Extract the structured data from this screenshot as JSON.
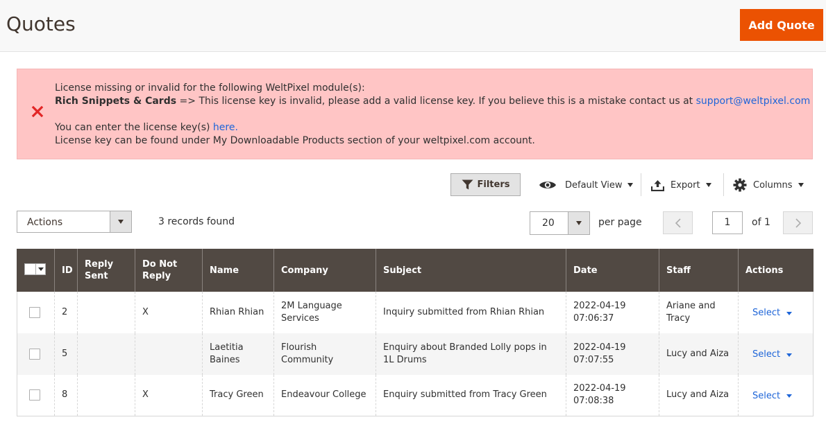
{
  "header": {
    "title": "Quotes",
    "add_button": "Add Quote"
  },
  "message": {
    "line1": "License missing or invalid for the following WeltPixel module(s):",
    "module_name": "Rich Snippets & Cards",
    "line2_rest": " => This license key is invalid, please add a valid license key. If you believe this is a mistake contact us at ",
    "support_email": "support@weltpixel.com",
    "line3_prefix": "You can enter the license key(s) ",
    "here_link": "here.",
    "line4": "License key can be found under My Downloadable Products section of your weltpixel.com account."
  },
  "toolbar": {
    "filters": "Filters",
    "view": "Default View",
    "export": "Export",
    "columns": "Columns"
  },
  "grid_controls": {
    "actions_label": "Actions",
    "records_found": "3 records found",
    "per_page_value": "20",
    "per_page_label": "per page",
    "current_page": "1",
    "page_of": "of 1"
  },
  "table": {
    "columns": [
      "ID",
      "Reply Sent",
      "Do Not Reply",
      "Name",
      "Company",
      "Subject",
      "Date",
      "Staff",
      "Actions"
    ],
    "rows": [
      {
        "id": "2",
        "reply_sent": "",
        "do_not_reply": "X",
        "name": "Rhian Rhian",
        "company": "2M Language Services",
        "subject": "Inquiry submitted from Rhian Rhian",
        "date": "2022-04-19 07:06:37",
        "staff": "Ariane and Tracy",
        "action": "Select"
      },
      {
        "id": "5",
        "reply_sent": "",
        "do_not_reply": "",
        "name": "Laetitia Baines",
        "company": "Flourish Community",
        "subject": "Enquiry about Branded Lolly pops in 1L Drums",
        "date": "2022-04-19 07:07:55",
        "staff": "Lucy and Aiza",
        "action": "Select"
      },
      {
        "id": "8",
        "reply_sent": "",
        "do_not_reply": "X",
        "name": "Tracy Green",
        "company": "Endeavour College",
        "subject": "Enquiry submitted from Tracy Green",
        "date": "2022-04-19 07:08:38",
        "staff": "Lucy and Aiza",
        "action": "Select"
      }
    ]
  },
  "colors": {
    "accent": "#eb5202",
    "error_bg": "#ffc5c5",
    "error_icon": "#e22626",
    "grid_header": "#514943",
    "link": "#1e65d8"
  },
  "icons": {
    "error": "close-x-icon",
    "filter": "funnel-icon",
    "view": "eye-icon",
    "export": "upload-icon",
    "columns": "gear-icon"
  }
}
